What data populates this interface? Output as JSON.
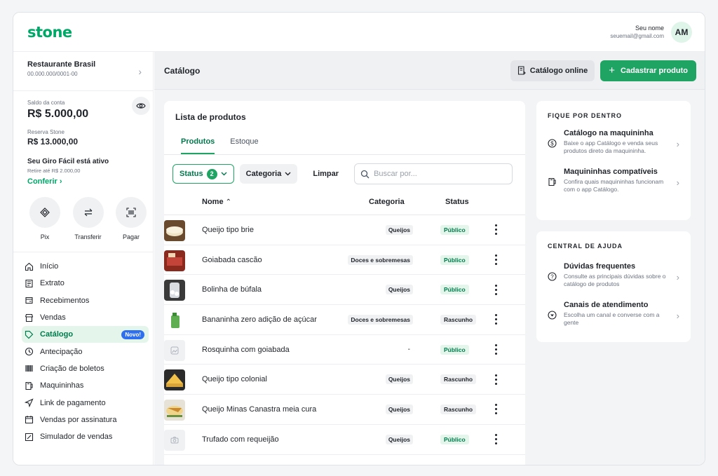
{
  "brand": {
    "logo": "stone",
    "accent": "#00a868"
  },
  "user": {
    "name": "Seu nome",
    "email": "seuemail@gmail.com",
    "initials": "AM"
  },
  "company": {
    "name": "Restaurante Brasil",
    "doc": "00.000.000/0001-00"
  },
  "balance": {
    "label": "Saldo da conta",
    "value": "R$ 5.000,00",
    "reserve_label": "Reserva Stone",
    "reserve_value": "R$ 13.000,00",
    "giro_title": "Seu Giro Fácil está ativo",
    "giro_sub": "Retire até R$ 2.000,00",
    "giro_link": "Conferir"
  },
  "quick_actions": [
    {
      "label": "Pix",
      "icon": "pix-icon"
    },
    {
      "label": "Transferir",
      "icon": "transfer-icon"
    },
    {
      "label": "Pagar",
      "icon": "barcode-scan-icon"
    }
  ],
  "nav": [
    {
      "label": "Início",
      "icon": "home-icon"
    },
    {
      "label": "Extrato",
      "icon": "statement-icon"
    },
    {
      "label": "Recebimentos",
      "icon": "receivables-icon"
    },
    {
      "label": "Vendas",
      "icon": "store-icon"
    },
    {
      "label": "Catálogo",
      "icon": "tag-icon",
      "active": true,
      "badge": "Novo!"
    },
    {
      "label": "Antecipação",
      "icon": "clock-icon"
    },
    {
      "label": "Criação de boletos",
      "icon": "barcode-icon"
    },
    {
      "label": "Maquininhas",
      "icon": "card-machine-icon"
    },
    {
      "label": "Link de pagamento",
      "icon": "send-icon"
    },
    {
      "label": "Vendas por assinatura",
      "icon": "calendar-icon"
    },
    {
      "label": "Simulador de vendas",
      "icon": "calculator-icon"
    }
  ],
  "page": {
    "title": "Catálogo",
    "online_button": "Catálogo online",
    "primary_button": "Cadastrar produto"
  },
  "products_card": {
    "title": "Lista de produtos",
    "tabs": [
      {
        "label": "Produtos",
        "active": true
      },
      {
        "label": "Estoque"
      }
    ],
    "filter_status": "Status",
    "filter_status_count": "2",
    "filter_category": "Categoria",
    "clear": "Limpar",
    "search_placeholder": "Buscar por...",
    "columns": {
      "name": "Nome",
      "category": "Categoria",
      "status": "Status"
    },
    "rows": [
      {
        "name": "Queijo tipo brie",
        "category": "Queijos",
        "status": "Público",
        "thumb": "brie"
      },
      {
        "name": "Goiabada cascão",
        "category": "Doces e sobremesas",
        "status": "Público",
        "thumb": "goiabada"
      },
      {
        "name": "Bolinha de búfala",
        "category": "Queijos",
        "status": "Público",
        "thumb": "bufala"
      },
      {
        "name": "Bananinha zero adição de açúcar",
        "category": "Doces e sobremesas",
        "status": "Rascunho",
        "thumb": "banana"
      },
      {
        "name": "Rosquinha com goiabada",
        "category": "-",
        "status": "Público",
        "thumb": "placeholder"
      },
      {
        "name": "Queijo tipo colonial",
        "category": "Queijos",
        "status": "Rascunho",
        "thumb": "colonial"
      },
      {
        "name": "Queijo Minas Canastra meia cura",
        "category": "Queijos",
        "status": "Rascunho",
        "thumb": "canastra"
      },
      {
        "name": "Trufado com requeijão",
        "category": "Queijos",
        "status": "Público",
        "thumb": "camera-placeholder"
      }
    ]
  },
  "aside_news": {
    "title": "FIQUE POR DENTRO",
    "items": [
      {
        "title": "Catálogo na maquininha",
        "text": "Baixe o app Catálogo e venda seus produtos direto da maquininha.",
        "icon": "dollar-circle-icon"
      },
      {
        "title": "Maquininhas compatíveis",
        "text": "Confira quais maquininhas funcionam com o app Catálogo.",
        "icon": "card-machine-icon"
      }
    ]
  },
  "aside_help": {
    "title": "CENTRAL DE AJUDA",
    "items": [
      {
        "title": "Dúvidas frequentes",
        "text": "Consulte as principais dúvidas sobre o catálogo de produtos",
        "icon": "question-circle-icon"
      },
      {
        "title": "Canais de atendimento",
        "text": "Escolha um canal e converse com a gente",
        "icon": "chat-circle-icon"
      }
    ]
  }
}
